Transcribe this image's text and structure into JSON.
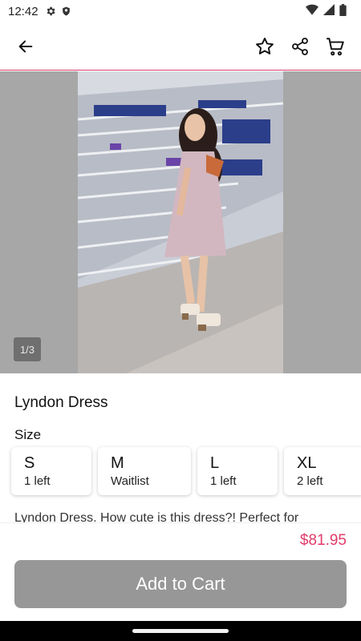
{
  "status_bar": {
    "time": "12:42",
    "icons_left": [
      "gear-icon",
      "shield-icon"
    ],
    "icons_right": [
      "wifi-icon",
      "signal-icon",
      "battery-icon"
    ]
  },
  "app_bar": {
    "back_icon": "arrow-left-icon",
    "actions": [
      "star-icon",
      "share-icon",
      "cart-icon"
    ],
    "accent_color": "#e23b6a"
  },
  "gallery": {
    "page_indicator": "1/3"
  },
  "product": {
    "title": "Lyndon Dress",
    "size_label": "Size",
    "sizes": [
      {
        "size": "S",
        "availability": "1 left"
      },
      {
        "size": "M",
        "availability": "Waitlist"
      },
      {
        "size": "L",
        "availability": "1 left"
      },
      {
        "size": "XL",
        "availability": "2 left"
      }
    ],
    "description": "Lyndon Dress. How cute is this dress?!  Perfect for",
    "price": "$81.95",
    "price_color": "#e23b6a",
    "add_to_cart_label": "Add to Cart"
  }
}
